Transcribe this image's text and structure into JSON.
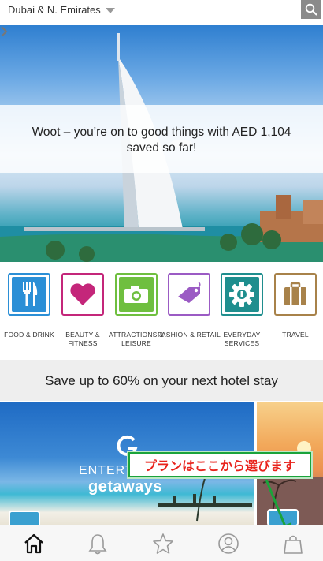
{
  "header": {
    "region": "Dubai & N. Emirates",
    "search_icon": "search-icon"
  },
  "hero": {
    "message": "Woot – you’re on to good things with AED 1,104 saved so far!"
  },
  "categories": [
    {
      "label": "FOOD & DRINK",
      "icon": "fork-knife-icon",
      "color": "#2b8fd6"
    },
    {
      "label": "BEAUTY & FITNESS",
      "icon": "heart-icon",
      "color": "#c4267a"
    },
    {
      "label": "ATTRACTIONS & LEISURE",
      "icon": "camera-icon",
      "color": "#6fbf3f"
    },
    {
      "label": "FASHION & RETAIL",
      "icon": "tag-icon",
      "color": "#9b5bc4"
    },
    {
      "label": "EVERYDAY SERVICES",
      "icon": "gear-icon",
      "color": "#1f8e8e"
    },
    {
      "label": "TRAVEL",
      "icon": "suitcase-icon",
      "color": "#a8824a"
    }
  ],
  "promo": {
    "title": "Save up to 60% on your next hotel stay",
    "brand_line1": "ENTERT",
    "brand_line2": "getaways"
  },
  "annotation": {
    "text": "プランはここから選びます",
    "border_color": "#1aa33a",
    "text_color": "#e8221b"
  },
  "bottom_nav": [
    "home-icon",
    "bell-icon",
    "star-icon",
    "profile-icon",
    "bag-icon"
  ]
}
